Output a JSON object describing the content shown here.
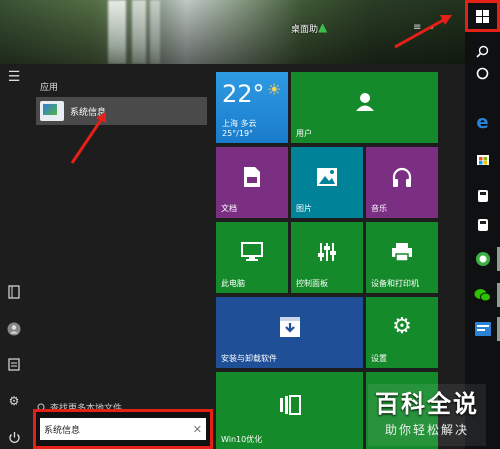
{
  "desktop": {
    "shortcut_label": "桌面助",
    "menu_glyph": "≡",
    "chevron_glyph": "⌄"
  },
  "taskbar": {
    "start_icon": "windows-logo-icon",
    "items": [
      "search-icon",
      "cortana-icon",
      "edge-icon",
      "store-icon",
      "pinned-app-icon",
      "pinned-app-icon",
      "green-app-icon",
      "wechat-icon",
      "blue-app-icon"
    ]
  },
  "start_menu": {
    "section_label": "应用",
    "result": {
      "label": "系统信息"
    },
    "search_more": "查找更多本地文件",
    "search_box": {
      "value": "系统信息",
      "clear_glyph": "✕"
    }
  },
  "tiles": {
    "weather": {
      "temp": "22°",
      "city": "上海  多云",
      "range": "25°/19°"
    },
    "user": "用户",
    "documents": "文档",
    "pictures": "图片",
    "music": "音乐",
    "this_pc": "此电脑",
    "control_panel": "控制面板",
    "devices_printers": "设备和打印机",
    "install_uninstall": "安装与卸载软件",
    "settings": "设置",
    "win10_optimize": "Win10优化"
  },
  "watermark": {
    "title": "百科全说",
    "subtitle": "助你轻松解决"
  },
  "colors": {
    "highlight_red": "#e52117",
    "tile_green": "#158a2a",
    "tile_purple": "#7a2f83",
    "tile_teal": "#008299",
    "tile_blue": "#1e4f97",
    "weather_blue": "#1a7ccc"
  }
}
